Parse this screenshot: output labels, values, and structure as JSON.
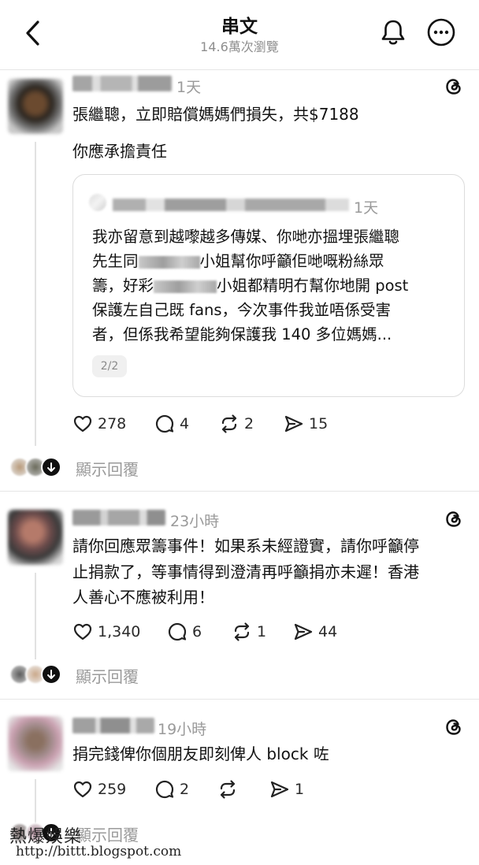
{
  "header": {
    "title": "串文",
    "views": "14.6萬次瀏覽",
    "back_icon": "chevron-left-icon",
    "bell_icon": "bell-icon",
    "more_icon": "more-circle-icon"
  },
  "posts": [
    {
      "time": "1天",
      "text_lines": [
        "張繼聰，立即賠償媽媽們損失，共$7188",
        "你應承擔責任"
      ],
      "quote": {
        "time": "1天",
        "line1": "我亦留意到越嚟越多傳媒、你哋亦搵埋張繼聰",
        "line2a": "先生同",
        "line2b": "小姐幫你呼籲佢哋嘅粉絲眾",
        "line3a": "籌，好彩",
        "line3b": "小姐都精明冇幫你地開 post",
        "line4": "保護左自己既 fans，今次事件我並唔係受害",
        "line5": "者，但係我希望能夠保護我 140 多位媽媽...",
        "page": "2/2"
      },
      "likes": "278",
      "comments": "4",
      "reposts": "2",
      "shares": "15",
      "replies_label": "顯示回覆"
    },
    {
      "time": "23小時",
      "text_lines": [
        "請你回應眾籌事件！如果系未經證實，請你呼籲停",
        "止捐款了，等事情得到澄清再呼籲捐亦未遲！香港",
        "人善心不應被利用！"
      ],
      "likes": "1,340",
      "comments": "6",
      "reposts": "1",
      "shares": "44",
      "replies_label": "顯示回覆"
    },
    {
      "time": "19小時",
      "text_lines": [
        "捐完錢俾你個朋友即刻俾人 block 咗"
      ],
      "likes": "259",
      "comments": "2",
      "reposts": "",
      "shares": "1",
      "replies_label": "顯示回覆"
    }
  ],
  "watermark": {
    "line1": "熱爆娛樂",
    "line2": "http://bittt.blogspot.com"
  },
  "colors": {
    "text": "#121212",
    "muted": "#9a9a9a",
    "divider": "#e6e6e6"
  }
}
